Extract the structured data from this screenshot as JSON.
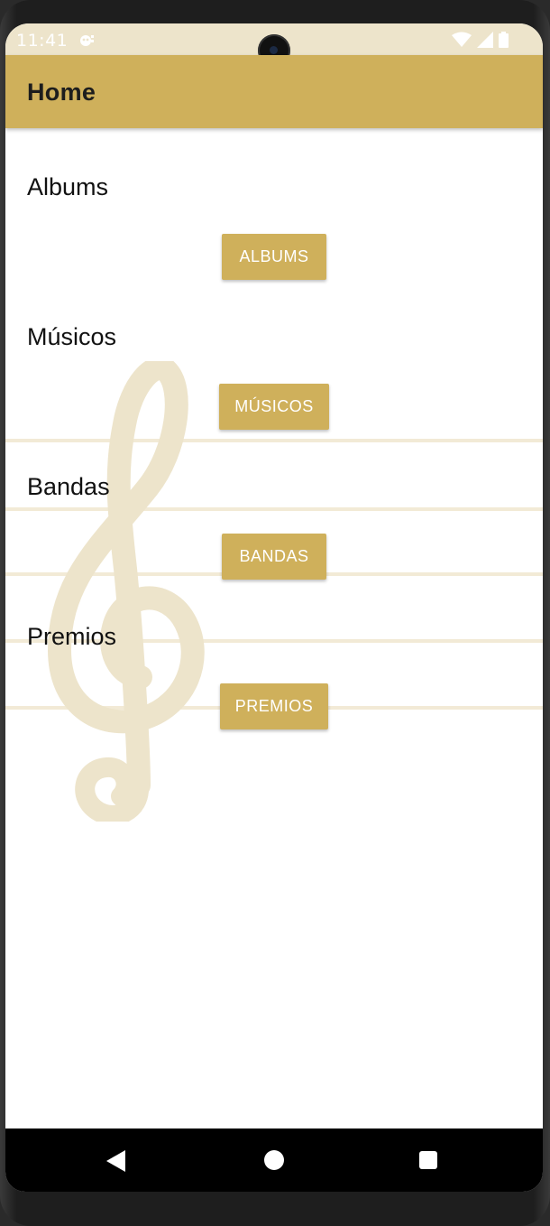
{
  "status_bar": {
    "time": "11:41",
    "icons": [
      "notification-icon",
      "wifi-icon",
      "signal-icon",
      "battery-icon"
    ]
  },
  "app_bar": {
    "title": "Home"
  },
  "sections": [
    {
      "label": "Albums",
      "button": "ALBUMS"
    },
    {
      "label": "Músicos",
      "button": "MÚSICOS"
    },
    {
      "label": "Bandas",
      "button": "BANDAS"
    },
    {
      "label": "Premios",
      "button": "PREMIOS"
    }
  ],
  "nav_bar": {
    "icons": [
      "back-icon",
      "home-icon",
      "recents-icon"
    ]
  },
  "colors": {
    "accent": "#cfb05b",
    "status_bar": "#ede4cb",
    "background_art": "#ede4cb"
  }
}
